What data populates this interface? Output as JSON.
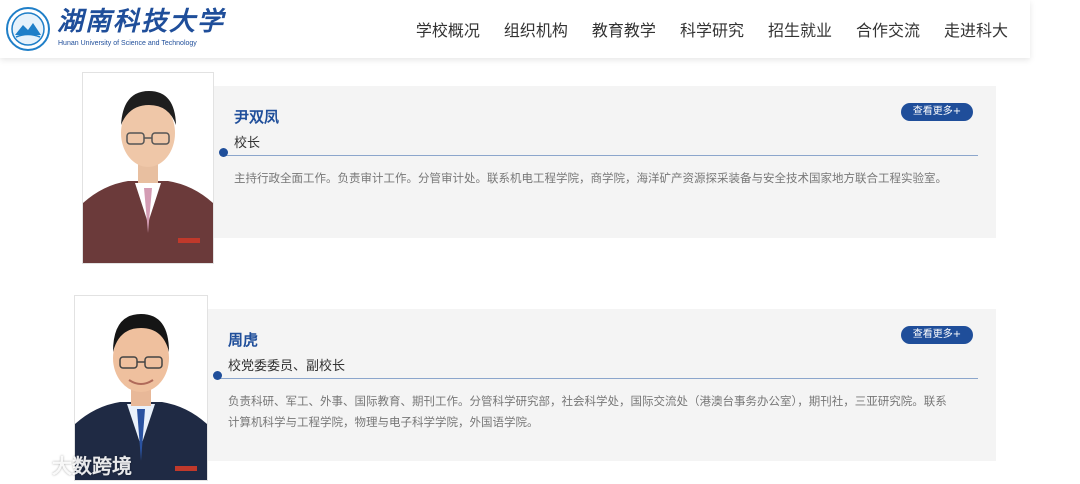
{
  "header": {
    "title": "湖南科技大学",
    "subtitle": "Hunan University of Science and Technology",
    "nav": [
      "学校概况",
      "组织机构",
      "教育教学",
      "科学研究",
      "招生就业",
      "合作交流",
      "走进科大"
    ]
  },
  "leaders": [
    {
      "name": "尹双凤",
      "title": "校长",
      "more": "查看更多+",
      "description": "主持行政全面工作。负责审计工作。分管审计处。联系机电工程学院，商学院，海洋矿产资源探采装备与安全技术国家地方联合工程实验室。"
    },
    {
      "name": "周虎",
      "title": "校党委委员、副校长",
      "more": "查看更多+",
      "description_line1": "负责科研、军工、外事、国际教育、期刊工作。分管科学研究部，社会科学处，国际交流处（港澳台事务办公室），期刊社，三亚研究院。联系",
      "description_line2": "计算机科学与工程学院，物理与电子科学学院，外国语学院。"
    }
  ],
  "watermark": "大数跨境",
  "colors": {
    "brand": "#1f4e9a",
    "card_bg": "#f4f4f4",
    "divider": "#8ca6cc"
  }
}
